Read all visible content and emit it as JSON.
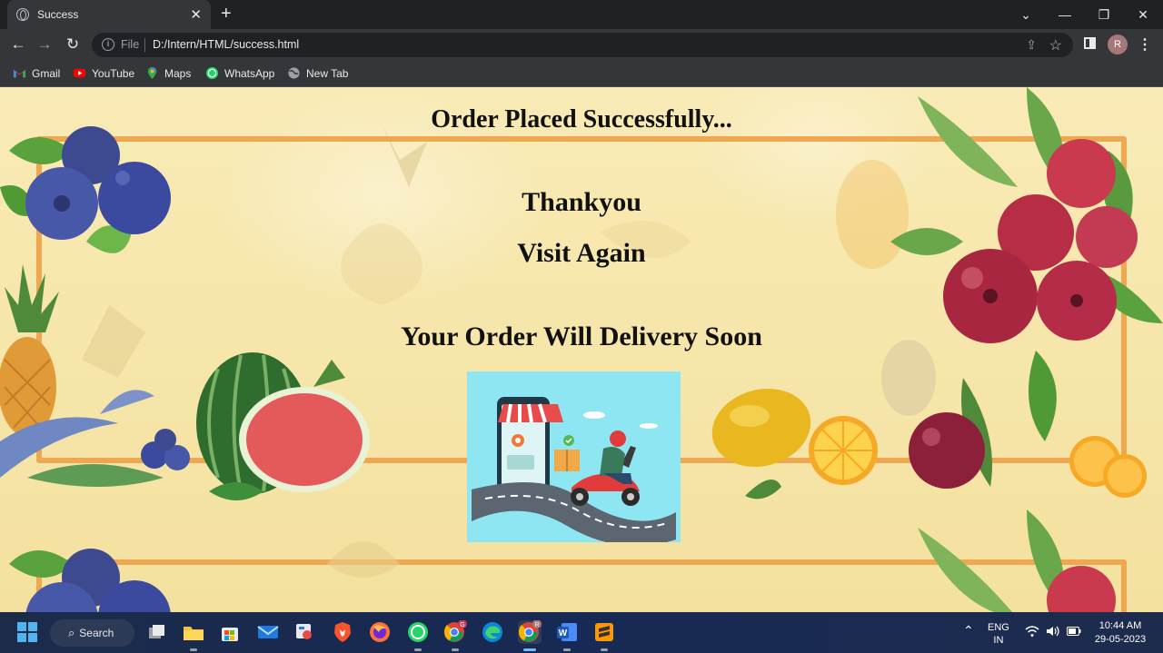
{
  "browser": {
    "tab_title": "Success",
    "url_scheme_label": "File",
    "url": "D:/Intern/HTML/success.html",
    "profile_initial": "R",
    "bookmarks": [
      {
        "label": "Gmail",
        "icon": "gmail-icon"
      },
      {
        "label": "YouTube",
        "icon": "youtube-icon"
      },
      {
        "label": "Maps",
        "icon": "maps-icon"
      },
      {
        "label": "WhatsApp",
        "icon": "whatsapp-icon"
      },
      {
        "label": "New Tab",
        "icon": "globe-icon"
      }
    ]
  },
  "page": {
    "heading": "Order Placed Successfully...",
    "thanks": "Thankyou",
    "visit": "Visit Again",
    "delivery": "Your Order Will Delivery Soon"
  },
  "taskbar": {
    "search_label": "Search",
    "language_top": "ENG",
    "language_bottom": "IN",
    "time": "10:44 AM",
    "date": "29-05-2023",
    "chrome_badge_1": "G",
    "chrome_badge_2": "R"
  },
  "colors": {
    "page_bg": "#f7e7ae",
    "frame": "#f0a752",
    "delivery_bg": "#8fe6f3"
  }
}
